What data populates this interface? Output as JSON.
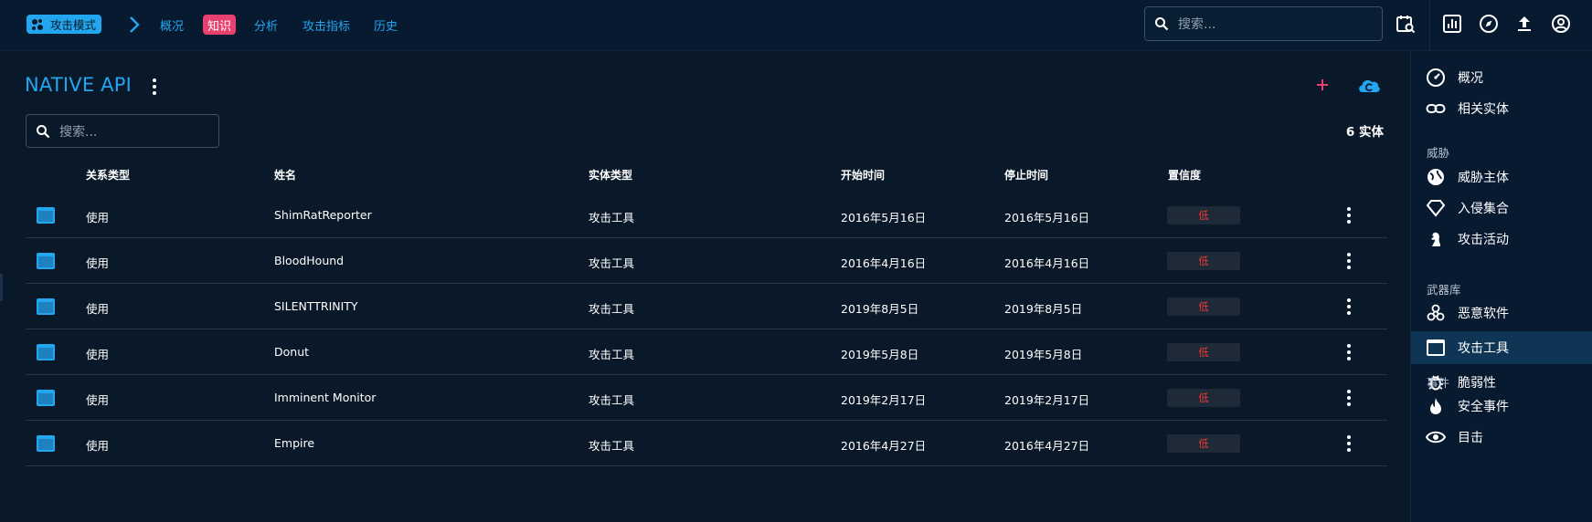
{
  "topbar": {
    "mode_label": "攻击模式",
    "nav": [
      "概况",
      "知识",
      "分析",
      "攻击指标",
      "历史"
    ],
    "active_nav": "知识",
    "search_placeholder": "搜索..."
  },
  "main": {
    "title": "NATIVE API",
    "search_placeholder": "搜索...",
    "entity_count": "6 实体",
    "columns": [
      "关系类型",
      "姓名",
      "实体类型",
      "开始时间",
      "停止时间",
      "置信度"
    ],
    "rows": [
      {
        "relation": "使用",
        "name": "ShimRatReporter",
        "type": "攻击工具",
        "start": "2016年5月16日",
        "stop": "2016年5月16日",
        "confidence": "低"
      },
      {
        "relation": "使用",
        "name": "BloodHound",
        "type": "攻击工具",
        "start": "2016年4月16日",
        "stop": "2016年4月16日",
        "confidence": "低"
      },
      {
        "relation": "使用",
        "name": "SILENTTRINITY",
        "type": "攻击工具",
        "start": "2019年8月5日",
        "stop": "2019年8月5日",
        "confidence": "低"
      },
      {
        "relation": "使用",
        "name": "Donut",
        "type": "攻击工具",
        "start": "2019年5月8日",
        "stop": "2019年5月8日",
        "confidence": "低"
      },
      {
        "relation": "使用",
        "name": "Imminent Monitor",
        "type": "攻击工具",
        "start": "2019年2月17日",
        "stop": "2019年2月17日",
        "confidence": "低"
      },
      {
        "relation": "使用",
        "name": "Empire",
        "type": "攻击工具",
        "start": "2016年4月27日",
        "stop": "2016年4月27日",
        "confidence": "低"
      }
    ]
  },
  "sidebar": {
    "items": [
      {
        "label": "概况",
        "icon": "gauge-icon"
      },
      {
        "label": "相关实体",
        "icon": "link-icon"
      },
      {
        "label": "威胁主体",
        "icon": "globe-icon"
      },
      {
        "label": "入侵集合",
        "icon": "diamond-icon"
      },
      {
        "label": "攻击活动",
        "icon": "chess-knight-icon"
      },
      {
        "label": "恶意软件",
        "icon": "biohazard-icon"
      },
      {
        "label": "攻击工具",
        "icon": "window-icon"
      },
      {
        "label": "脆弱性",
        "icon": "bug-icon"
      },
      {
        "label": "安全事件",
        "icon": "fire-icon"
      },
      {
        "label": "目击",
        "icon": "eye-icon"
      }
    ],
    "sections": [
      "威胁",
      "武器库",
      "事件"
    ],
    "selected": "攻击工具"
  },
  "colors": {
    "background": "#0a1929",
    "accent": "#23a6f0",
    "active_tab": "#e8416f",
    "confidence_low": "#e53935"
  }
}
